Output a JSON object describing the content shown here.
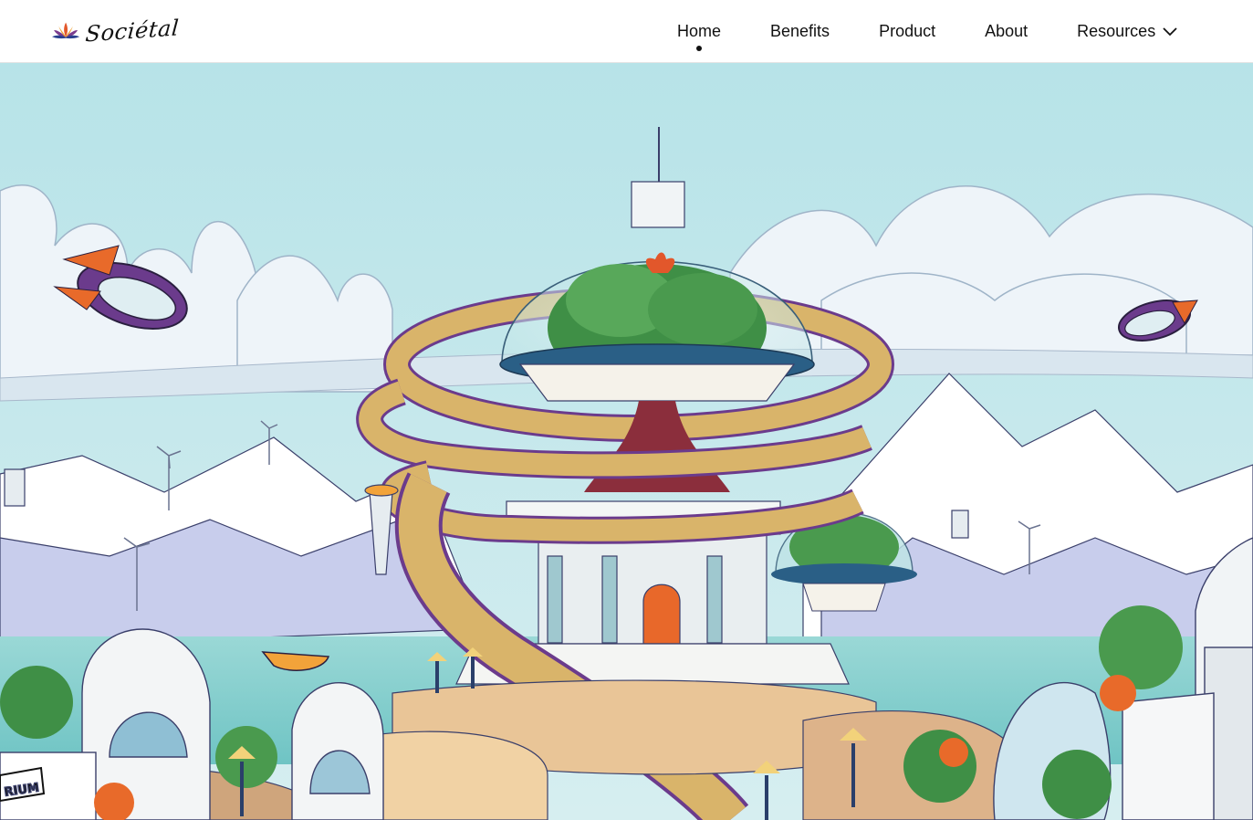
{
  "brand": {
    "name": "Sociétal"
  },
  "nav": {
    "items": [
      {
        "label": "Home"
      },
      {
        "label": "Benefits"
      },
      {
        "label": "Product"
      },
      {
        "label": "About"
      },
      {
        "label": "Resources"
      }
    ],
    "active": "Home"
  },
  "hero": {
    "sign_text": "RIUM"
  },
  "colors": {
    "sky": "#bfe6ea",
    "cloud": "#eaf3f8",
    "mountain": "#c9cdea",
    "sea": "#8fd3d3",
    "path": "#d9b46a",
    "path_edge": "#6b3b8c",
    "tree": "#3f8f46",
    "trunk": "#8b2e3c",
    "accent_orange": "#e86a2a"
  },
  "icons": [
    "lotus-logo-icon",
    "chevron-down-icon"
  ]
}
